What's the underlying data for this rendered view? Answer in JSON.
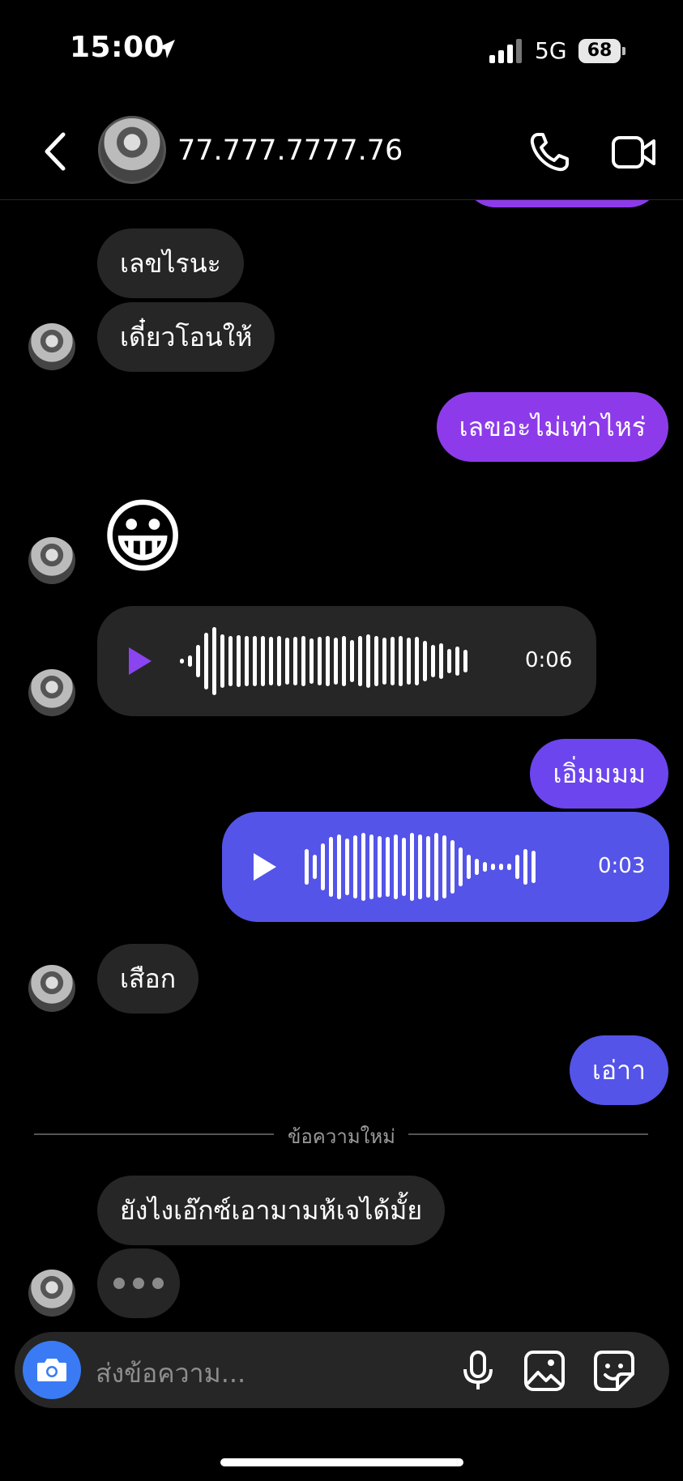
{
  "status_bar": {
    "time": "15:00",
    "network": "5G",
    "battery": "68"
  },
  "header": {
    "contact_name": "77.777.7777.76"
  },
  "messages": {
    "m1": "เลขไรนะ",
    "m2": "เดี๋ยวโอนให้",
    "m3": "เลขอะไม่เท่าไหร่",
    "m4": "😀",
    "m5_duration": "0:06",
    "m6": "เอิ่มมมม",
    "m7_duration": "0:03",
    "m8": "เสือก",
    "m9": "เอ่าา",
    "m10": "ยังไงเอ๊กซ์เอามามห้เจได้มั้ย"
  },
  "divider": {
    "new_messages_label": "ข้อความใหม่"
  },
  "composer": {
    "placeholder": "ส่งข้อความ..."
  },
  "colors": {
    "incoming": "#262626",
    "outgoing_purple": "#8d3bea",
    "outgoing_violet": "#6c45ee",
    "outgoing_blue": "#5454e8",
    "camera_button": "#3a7bf5"
  }
}
